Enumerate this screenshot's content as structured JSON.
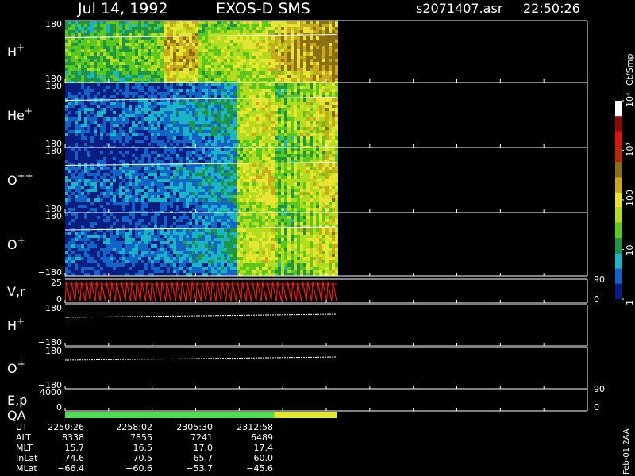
{
  "header": {
    "date": "Jul 14, 1992",
    "mission": "EXOS-D SMS",
    "file": "s2071407.asr",
    "time": "22:50:26"
  },
  "colorbar": {
    "unit": "Ct/Smp",
    "labels": [
      "1",
      "10",
      "100",
      "10³",
      "10⁴"
    ],
    "colors": [
      "#0a1e82",
      "#1464c8",
      "#19b4c8",
      "#1e9646",
      "#5ac81e",
      "#b4dc1e",
      "#e6e632",
      "#c8aa1e",
      "#8c6e14",
      "#b42814",
      "#dc1414",
      "#8c0a0a",
      "#ffffff"
    ]
  },
  "footer_note": "Feb-01 2AA",
  "chart_data": {
    "type": "heatmap",
    "title": "Jul 14, 1992    EXOS-D SMS",
    "time_range": [
      "2250:26",
      "2317:00"
    ],
    "data_end_fraction": 0.52,
    "panels": [
      {
        "label": "H",
        "ion_sup": "+",
        "top": "180",
        "bottom": "−180",
        "kind": "spectrogram",
        "peak_band": [
          0.36,
          0.48
        ],
        "early_level": 3,
        "late_level": 7
      },
      {
        "label": "He",
        "ion_sup": "+",
        "top": "180",
        "bottom": "−180",
        "kind": "spectrogram",
        "peak_band": [
          0.62,
          0.76
        ],
        "early_level": 0,
        "late_level": 5
      },
      {
        "label": "O",
        "ion_sup": "++",
        "top": "180",
        "bottom": "−180",
        "kind": "spectrogram",
        "peak_band": [
          0.62,
          0.76
        ],
        "early_level": 0,
        "late_level": 5
      },
      {
        "label": "O",
        "ion_sup": "+",
        "top": "180",
        "bottom": "−180",
        "kind": "spectrogram",
        "peak_band": [
          0.62,
          0.76
        ],
        "early_level": 0,
        "late_level": 5
      },
      {
        "label": "V,r",
        "ion_sup": "",
        "top": "25",
        "bottom": "0",
        "right_top": "90",
        "right_bottom": "0",
        "kind": "velocity"
      },
      {
        "label": "H",
        "ion_sup": "+",
        "top": "180",
        "bottom": "−180",
        "kind": "line"
      },
      {
        "label": "O",
        "ion_sup": "+",
        "top": "180",
        "bottom": "−180",
        "kind": "line"
      },
      {
        "label": "E,p",
        "ion_sup": "",
        "top": "4000",
        "bottom": "0",
        "right_top": "90",
        "right_bottom": "0",
        "kind": "energy"
      },
      {
        "label": "QA",
        "ion_sup": "",
        "kind": "qa",
        "segments": [
          {
            "start": 0.0,
            "end": 0.4,
            "color": "#50dc50"
          },
          {
            "start": 0.4,
            "end": 0.52,
            "color": "#e6e628"
          }
        ]
      }
    ],
    "ephemeris": {
      "rows": [
        "UT",
        "ALT",
        "MLT",
        "InLat",
        "MLat"
      ],
      "columns": [
        {
          "UT": "2250:26",
          "ALT": "8338",
          "MLT": "15.7",
          "InLat": "74.6",
          "MLat": "−66.4"
        },
        {
          "UT": "2258:02",
          "ALT": "7855",
          "MLT": "16.5",
          "InLat": "70.5",
          "MLat": "−60.6"
        },
        {
          "UT": "2305:30",
          "ALT": "7241",
          "MLT": "17.0",
          "InLat": "65.7",
          "MLat": "−53.7"
        },
        {
          "UT": "2312:58",
          "ALT": "6489",
          "MLT": "17.4",
          "InLat": "60.0",
          "MLat": "−45.6"
        }
      ]
    }
  }
}
